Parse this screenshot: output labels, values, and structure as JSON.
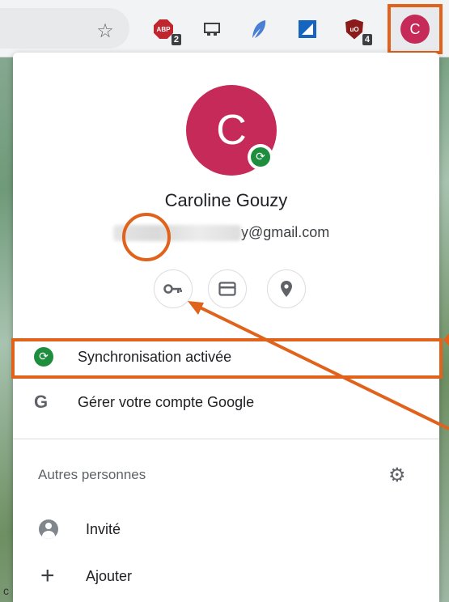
{
  "toolbar": {
    "abp_text": "ABP",
    "abp_badge": "2",
    "ublock_text": "uO",
    "ublock_badge": "4",
    "profile_initial": "C",
    "icons": [
      "star-icon",
      "adblock-plus-icon",
      "cast-icon",
      "feather-icon",
      "square-extension-icon",
      "ublock-icon"
    ]
  },
  "profile": {
    "initial": "C",
    "name": "Caroline Gouzy",
    "email_visible": "y@gmail.com",
    "avatar_color": "#c62a59"
  },
  "quick_actions": [
    "key-icon",
    "card-icon",
    "location-pin-icon"
  ],
  "menu": {
    "sync_label": "Synchronisation activée",
    "manage_label": "Gérer votre compte Google",
    "google_letter": "G",
    "others_title": "Autres personnes",
    "guest_label": "Invité",
    "add_label": "Ajouter"
  },
  "page": {
    "bottom_letter": "c"
  },
  "colors": {
    "highlight": "#e0621b",
    "sync_green": "#1e8e3e"
  }
}
